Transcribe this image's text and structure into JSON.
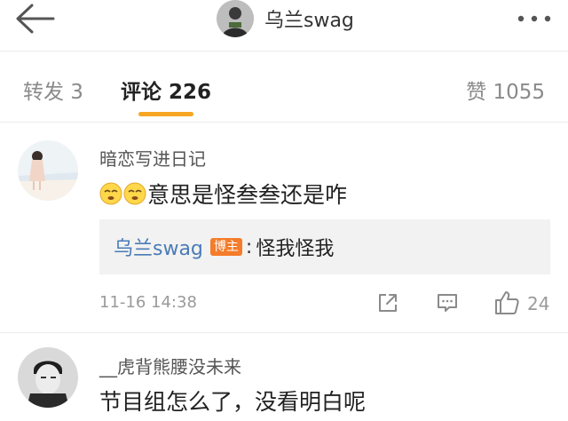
{
  "header": {
    "back_icon": "back-arrow-icon",
    "title": "乌兰swag",
    "more_icon": "more-horizontal-icon"
  },
  "tabs": {
    "reposts": "转发 3",
    "comments": "评论 226",
    "likes": "赞 1055",
    "active": "comments",
    "accent_color": "#f6a623"
  },
  "comments": [
    {
      "username": "暗恋写进日记",
      "text": "意思是怪叁叁还是咋",
      "emoji_prefix": [
        "sleepy-face-emoji",
        "sleepy-face-emoji"
      ],
      "reply": {
        "username": "乌兰swag",
        "badge": "博主",
        "separator": ":",
        "text": "怪我怪我"
      },
      "time": "11-16 14:38",
      "like_count": "24"
    },
    {
      "username": "__虎背熊腰没未来",
      "text": "节目组怎么了，没看明白呢"
    }
  ],
  "colors": {
    "link": "#4a7bb7",
    "badge": "#f47c2a"
  }
}
